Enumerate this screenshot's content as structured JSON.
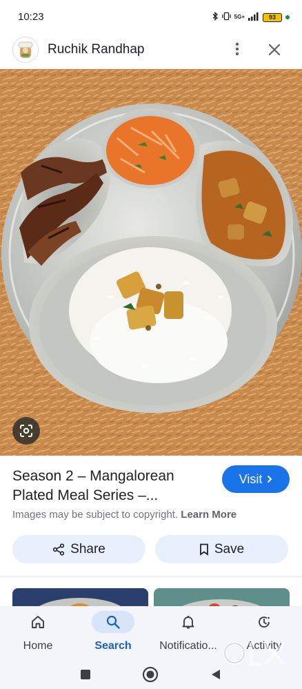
{
  "status_bar": {
    "time": "10:23",
    "network": "5G+",
    "battery": "93",
    "icons": [
      "bluetooth-icon",
      "vibrate-icon",
      "signal-icon",
      "battery-icon",
      "notification-dot-icon"
    ]
  },
  "header": {
    "site_name": "Ruchik Randhap",
    "icons": [
      "site-logo-icon",
      "more-vert-icon",
      "close-icon"
    ]
  },
  "result": {
    "title": "Season 2 – Mangalorean Plated Meal Series –...",
    "visit_label": "Visit",
    "copyright_text": "Images may be subject to copyright.",
    "learn_more_label": "Learn More",
    "share_label": "Share",
    "save_label": "Save"
  },
  "bottom_nav": {
    "items": [
      {
        "label": "Home",
        "icon": "home-icon",
        "active": false
      },
      {
        "label": "Search",
        "icon": "search-icon",
        "active": true
      },
      {
        "label": "Notificatio...",
        "icon": "bell-icon",
        "active": false
      },
      {
        "label": "Activity",
        "icon": "activity-icon",
        "active": false
      }
    ]
  },
  "system_nav": {
    "icons": [
      "recents-icon",
      "home-circle-icon",
      "back-icon"
    ]
  },
  "colors": {
    "accent": "#1a73e8",
    "chip_bg": "#e8f0fe",
    "nav_bg": "#f3f5fa",
    "nav_active": "#1a5fc7",
    "battery": "#f2c200"
  }
}
